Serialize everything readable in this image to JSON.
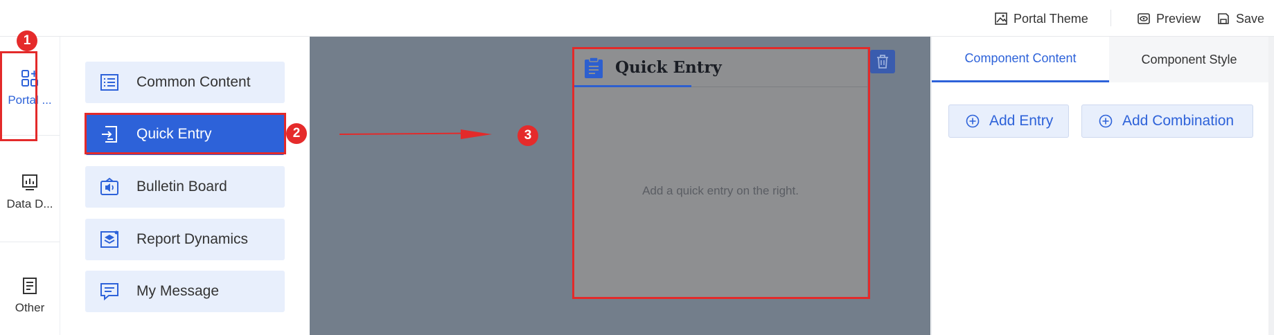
{
  "topbar": {
    "portal_theme": "Portal Theme",
    "preview": "Preview",
    "save": "Save"
  },
  "leftrail": {
    "items": [
      {
        "label": "Portal ...",
        "icon": "apps-add-icon",
        "active": true
      },
      {
        "label": "Data D...",
        "icon": "chart-icon",
        "active": false
      },
      {
        "label": "Other",
        "icon": "document-icon",
        "active": false
      }
    ]
  },
  "palette": {
    "items": [
      {
        "label": "Common Content",
        "icon": "list-icon"
      },
      {
        "label": "Quick Entry",
        "icon": "entry-icon",
        "active": true
      },
      {
        "label": "Bulletin Board",
        "icon": "megaphone-icon"
      },
      {
        "label": "Report Dynamics",
        "icon": "layers-icon"
      },
      {
        "label": "My Message",
        "icon": "message-icon"
      }
    ]
  },
  "canvas": {
    "card": {
      "title": "Quick Entry",
      "empty_text": "Add a quick entry on the right."
    }
  },
  "rightpanel": {
    "tabs": [
      {
        "label": "Component Content",
        "active": true
      },
      {
        "label": "Component Style",
        "active": false
      }
    ],
    "buttons": {
      "add_entry": "Add Entry",
      "add_combination": "Add Combination"
    }
  },
  "annotations": {
    "badges": [
      "1",
      "2",
      "3"
    ]
  },
  "colors": {
    "accent": "#2d62d9",
    "highlight": "#e32a2a",
    "canvas": "#737e8b"
  }
}
